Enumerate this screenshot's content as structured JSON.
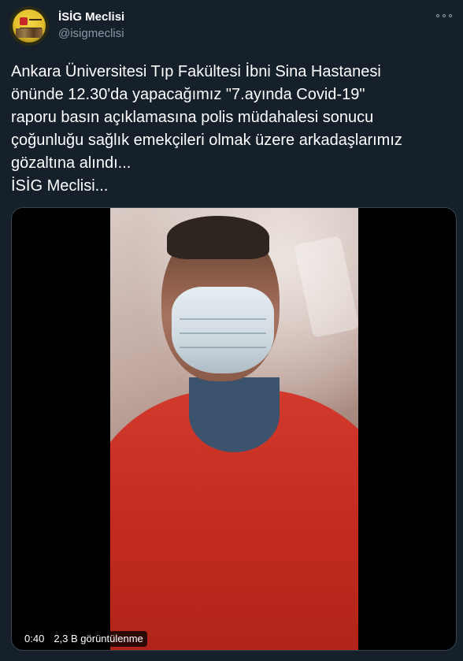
{
  "author": {
    "display_name": "İSİG Meclisi",
    "handle": "@isigmeclisi"
  },
  "tweet": {
    "text": "Ankara Üniversitesi Tıp Fakültesi İbni Sina Hastanesi\nönünde 12.30'da yapacağımız \"7.ayında Covid-19\"\nraporu basın açıklamasına polis müdahalesi sonucu\nçoğunluğu sağlık emekçileri olmak üzere arkadaşlarımız\ngözaltına alındı...\nİSİG Meclisi..."
  },
  "media": {
    "duration": "0:40",
    "views": "2,3 B görüntülenme"
  },
  "icons": {
    "more": "more-dots-icon",
    "avatar": "organization-logo"
  },
  "colors": {
    "background": "#15202b",
    "secondary_text": "#8899a6",
    "primary_text": "#ffffff",
    "media_border": "#38444d"
  }
}
